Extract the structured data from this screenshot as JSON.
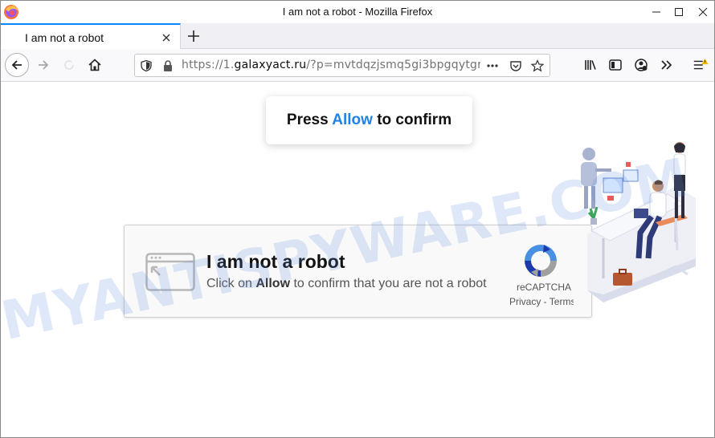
{
  "window": {
    "title": "I am not a robot - Mozilla Firefox"
  },
  "tabs": [
    {
      "label": "I am not a robot",
      "active": true
    }
  ],
  "urlbar": {
    "scheme": "https://1.",
    "host": "galaxyact.ru",
    "path": "/?p=mvtdqzjsmq5gi3bpgqytgr"
  },
  "page": {
    "press_prefix": "Press ",
    "press_allow": "Allow",
    "press_suffix": " to confirm",
    "captcha_title": "I am not a robot",
    "captcha_sub_prefix": "Click on ",
    "captcha_sub_allow": "Allow",
    "captcha_sub_suffix": " to confirm that you are not a robot",
    "recaptcha_label": "reCAPTCHA",
    "recaptcha_links": "Privacy - Terms"
  },
  "watermark": "MYANTISPYWARE.COM",
  "colors": {
    "accent_blue": "#1f82e4",
    "tab_highlight": "#0a84ff",
    "warning_badge": "#f5b400"
  }
}
